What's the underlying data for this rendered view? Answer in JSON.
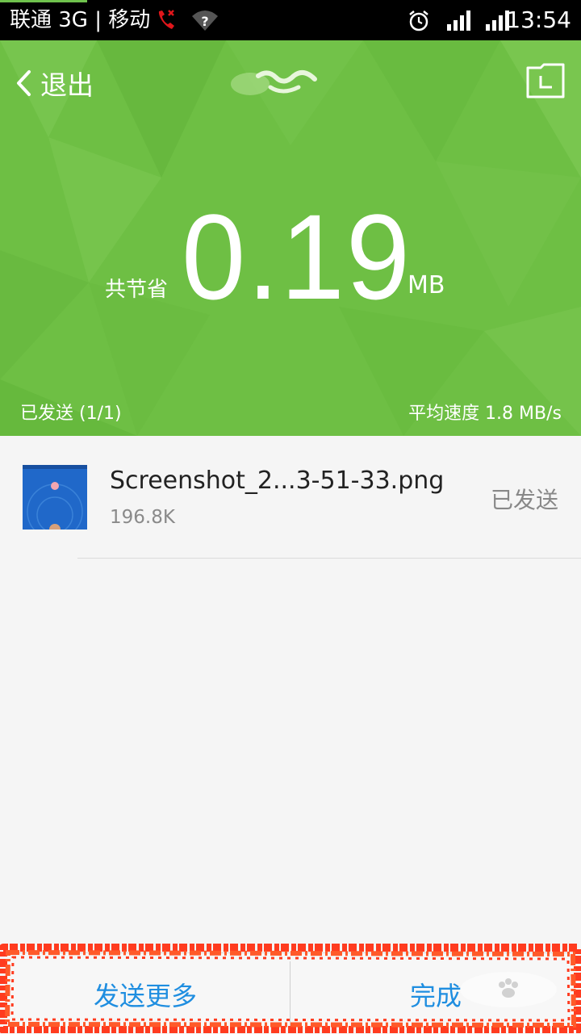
{
  "status_bar": {
    "carrier": "联通 3G | 移动",
    "time": "13:54",
    "icons": [
      "call-icon",
      "wifi-unknown-icon",
      "alarm-icon",
      "signal-icon",
      "signal-icon"
    ]
  },
  "header": {
    "back_label": "退出",
    "saved_label": "共节省",
    "saved_value": "0.19",
    "saved_unit": "MB",
    "sent_count": "已发送 (1/1)",
    "avg_speed": "平均速度 1.8 MB/s"
  },
  "files": [
    {
      "name": "Screenshot_2...3-51-33.png",
      "size": "196.8K",
      "status": "已发送"
    }
  ],
  "footer": {
    "send_more_label": "发送更多",
    "done_label": "完成"
  },
  "colors": {
    "header_green": "#6fbf45",
    "accent_blue": "#1f8ee0",
    "annotation_red": "#ff3b1f"
  }
}
